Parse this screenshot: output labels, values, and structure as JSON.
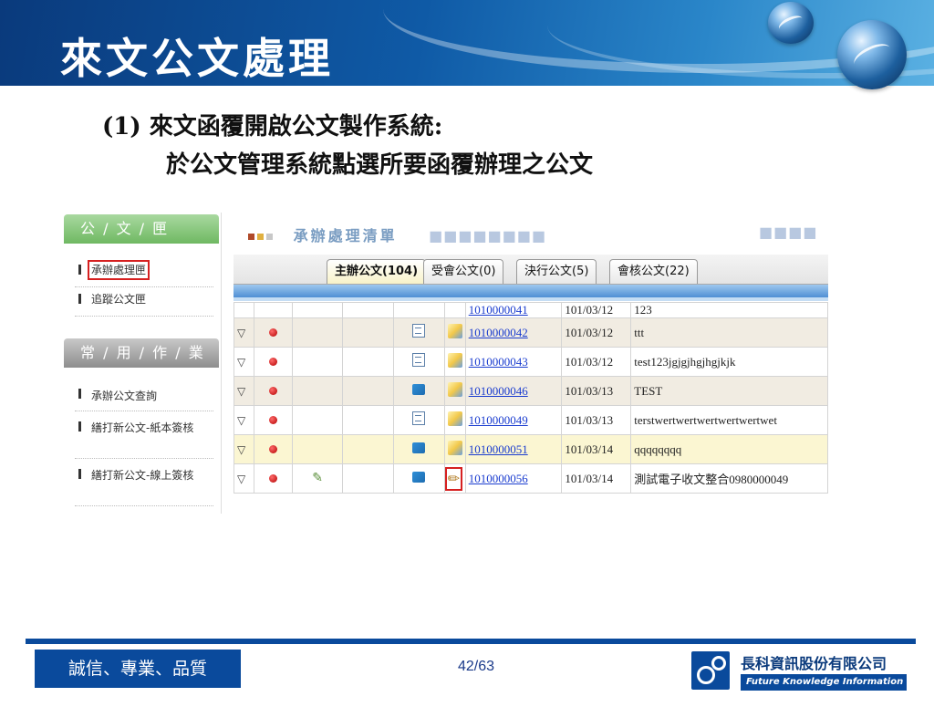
{
  "slide": {
    "title": "來文公文處理",
    "subtitle_line1": "(1) 來文函覆開啟公文製作系統:",
    "subtitle_line2": "於公文管理系統點選所要函覆辦理之公文"
  },
  "sidebar": {
    "section1": "公 / 文 / 匣",
    "items1": [
      "承辦處理匣",
      "追蹤公文匣"
    ],
    "section2": "常 / 用 / 作 / 業",
    "items2": [
      "承辦公文查詢",
      "繕打新公文-紙本簽核",
      "繕打新公文-線上簽核"
    ]
  },
  "main": {
    "list_title": "承辦處理清單",
    "tabs": [
      "主辦公文(104)",
      "受會公文(0)",
      "決行公文(5)",
      "會核公文(22)"
    ],
    "rows": [
      {
        "number": "1010000041",
        "date": "101/03/12",
        "subject": "123"
      },
      {
        "number": "1010000042",
        "date": "101/03/12",
        "subject": "ttt"
      },
      {
        "number": "1010000043",
        "date": "101/03/12",
        "subject": "test123jgjgjhgjhgjkjk"
      },
      {
        "number": "1010000046",
        "date": "101/03/13",
        "subject": "TEST"
      },
      {
        "number": "1010000049",
        "date": "101/03/13",
        "subject": "terstwertwertwertwertwertwet"
      },
      {
        "number": "1010000051",
        "date": "101/03/14",
        "subject": "qqqqqqqq"
      },
      {
        "number": "1010000056",
        "date": "101/03/14",
        "subject": "測試電子收文整合0980000049"
      }
    ]
  },
  "footer": {
    "motto": "誠信、專業、品質",
    "page": "42/63",
    "company": "長科資訊股份有限公司",
    "company_en": "Future Knowledge Information Co.,"
  },
  "colors": {
    "banner": "#0f5aa6",
    "footer_blue": "#0a4a9c",
    "highlight_red": "#d62020"
  }
}
